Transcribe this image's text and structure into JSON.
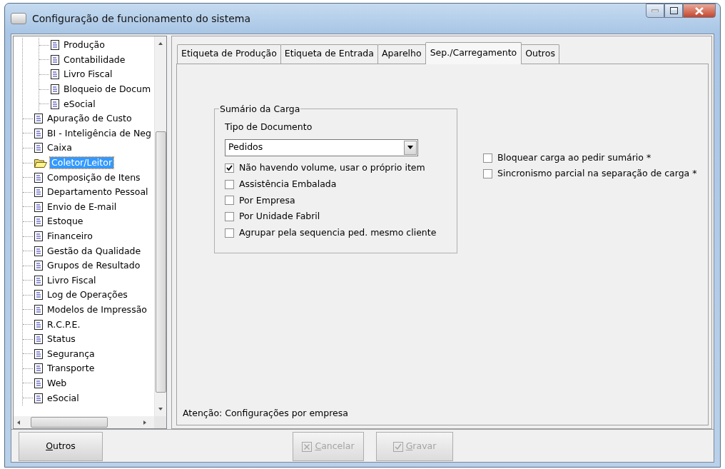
{
  "window": {
    "title": "Configuração de funcionamento do sistema"
  },
  "tree": {
    "items": [
      {
        "children": [
          {
            "label": "Produção",
            "kind": "document",
            "selected": false
          },
          {
            "label": "Contabilidade",
            "kind": "document",
            "selected": false
          },
          {
            "label": "Livro Fiscal",
            "kind": "document",
            "selected": false
          },
          {
            "label": "Bloqueio de Docum",
            "kind": "document",
            "selected": false
          },
          {
            "label": "eSocial",
            "kind": "document",
            "selected": false
          }
        ]
      },
      {
        "label": "Apuração de Custo",
        "kind": "document",
        "selected": false
      },
      {
        "label": "BI - Inteligência de Neg",
        "kind": "document",
        "selected": false
      },
      {
        "label": "Caixa",
        "kind": "document",
        "selected": false
      },
      {
        "label": "Coletor/Leitor",
        "kind": "folder",
        "selected": true
      },
      {
        "label": "Composição de Itens",
        "kind": "document",
        "selected": false
      },
      {
        "label": "Departamento Pessoal",
        "kind": "document",
        "selected": false
      },
      {
        "label": "Envio de E-mail",
        "kind": "document",
        "selected": false
      },
      {
        "label": "Estoque",
        "kind": "document",
        "selected": false
      },
      {
        "label": "Financeiro",
        "kind": "document",
        "selected": false
      },
      {
        "label": "Gestão da Qualidade",
        "kind": "document",
        "selected": false
      },
      {
        "label": "Grupos de Resultado",
        "kind": "document",
        "selected": false
      },
      {
        "label": "Livro Fiscal",
        "kind": "document",
        "selected": false
      },
      {
        "label": "Log de Operações",
        "kind": "document",
        "selected": false
      },
      {
        "label": "Modelos de Impressão",
        "kind": "document",
        "selected": false
      },
      {
        "label": "R.C.P.E.",
        "kind": "document",
        "selected": false
      },
      {
        "label": "Status",
        "kind": "document",
        "selected": false
      },
      {
        "label": "Segurança",
        "kind": "document",
        "selected": false
      },
      {
        "label": "Transporte",
        "kind": "document",
        "selected": false
      },
      {
        "label": "Web",
        "kind": "document",
        "selected": false
      },
      {
        "label": "eSocial",
        "kind": "document",
        "selected": false
      }
    ]
  },
  "tabs": [
    {
      "label": "Etiqueta de Produção",
      "selected": false
    },
    {
      "label": "Etiqueta de Entrada",
      "selected": false
    },
    {
      "label": "Aparelho",
      "selected": false
    },
    {
      "label": "Sep./Carregamento",
      "selected": true
    },
    {
      "label": "Outros",
      "selected": false
    }
  ],
  "group": {
    "title": "Sumário da Carga",
    "field_label": "Tipo de Documento",
    "dropdown": {
      "value": "Pedidos"
    },
    "checkboxes": [
      {
        "label": "Não havendo volume, usar o próprio item",
        "checked": true
      },
      {
        "label": "Assistência Embalada",
        "checked": false
      },
      {
        "label": "Por Empresa",
        "checked": false
      },
      {
        "label": "Por Unidade Fabril",
        "checked": false
      },
      {
        "label": "Agrupar pela sequencia ped. mesmo cliente",
        "checked": false
      }
    ]
  },
  "side_checkboxes": [
    {
      "label": "Bloquear carga ao pedir sumário *",
      "checked": false
    },
    {
      "label": "Sincronismo parcial na separação de carga *",
      "checked": false
    }
  ],
  "footer_note": "Atenção: Configurações por empresa",
  "buttons": [
    {
      "label": "Outros",
      "kind": "plain",
      "disabled": false
    },
    {
      "label": "Cancelar",
      "kind": "cancel",
      "disabled": true
    },
    {
      "label": "Gravar",
      "kind": "save",
      "disabled": true
    }
  ]
}
